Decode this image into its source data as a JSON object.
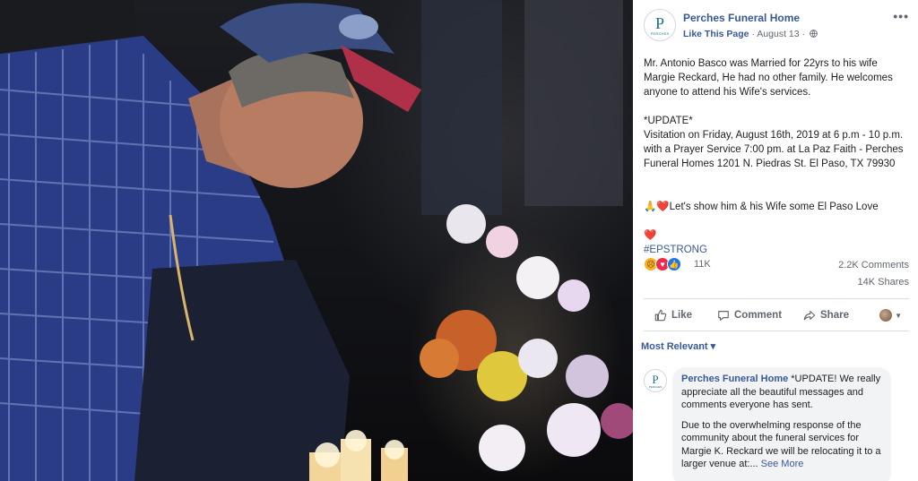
{
  "post": {
    "page_name": "Perches Funeral Home",
    "avatar_letter": "P",
    "avatar_sub": "PERCHES",
    "like_page": "Like This Page",
    "separator": "·",
    "date": "August 13",
    "separator2": "·",
    "more": "•••",
    "body_p1": "Mr. Antonio Basco was Married for 22yrs to his wife Margie Reckard, He had no other family. He welcomes anyone to attend his Wife's services.",
    "body_p2": "*UPDATE*\nVisitation on Friday, August 16th, 2019 at 6 p.m - 10 p.m. with a Prayer Service 7:00 pm. at La Paz Faith - Perches Funeral Homes 1201 N. Piedras St. El Paso, TX 79930",
    "emoji_pray": "🙏",
    "emoji_heart": "❤️",
    "body_p3": "Let's show him & his Wife some El Paso Love",
    "emoji_heart2": "❤️",
    "hashtag": "#EPSTRONG"
  },
  "stats": {
    "reaction_count": "11K",
    "comments": "2.2K Comments",
    "shares": "14K Shares"
  },
  "actions": {
    "like": "Like",
    "comment": "Comment",
    "share": "Share"
  },
  "comments_section": {
    "filter": "Most Relevant ▾",
    "first_comment": {
      "author": "Perches Funeral Home",
      "avatar_letter": "P",
      "avatar_sub": "PERCHES",
      "text_p1": " *UPDATE! We really appreciate all the beautiful messages and comments everyone has sent.",
      "text_p2": "Due to the overwhelming response of the community about the funeral services for Margie K. Reckard we will be relocating it to a larger venue at:...",
      "see_more": "See More"
    }
  },
  "colors": {
    "link": "#385898",
    "meta": "#616770",
    "like_blue": "#1877f2",
    "love_red": "#f0284a",
    "sad_yellow": "#f7b125"
  }
}
